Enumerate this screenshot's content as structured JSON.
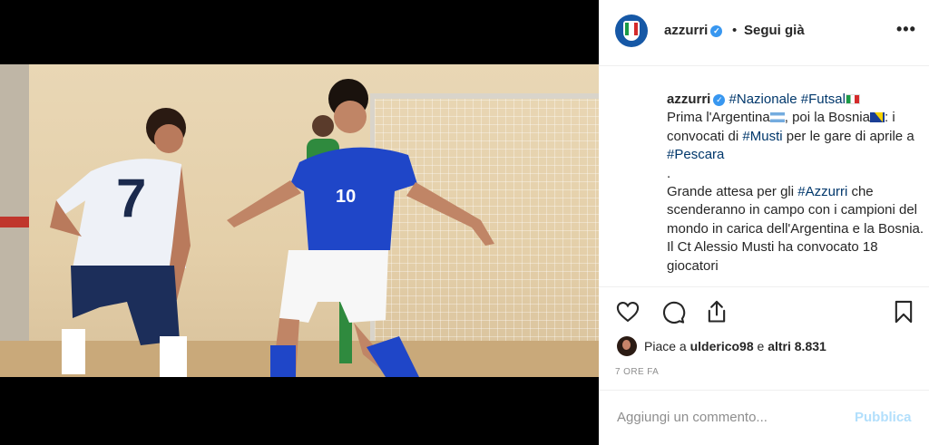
{
  "header": {
    "username": "azzurri",
    "separator": "•",
    "follow_label": "Segui già",
    "more": "•••"
  },
  "caption": {
    "username": "azzurri",
    "tags": [
      "#Nazionale",
      "#Futsal"
    ],
    "line2a": "Prima l'Argentina",
    "line2b": ", poi la Bosnia",
    "line2c": ": i convocati di ",
    "tag_musti": "#Musti",
    "line3": " per le gare di aprile a ",
    "tag_pescara": "#Pescara",
    "dot1": ".",
    "para_a": "Grande attesa per gli ",
    "tag_azzurri": "#Azzurri",
    "para_b": " che scenderanno in campo con i campioni del mondo in carica dell'Argentina e la Bosnia. Il Ct Alessio Musti ha convocato 18 giocatori",
    "dot2": "."
  },
  "actions": {
    "like": "heart-icon",
    "comment": "comment-icon",
    "share": "share-icon",
    "save": "bookmark-icon"
  },
  "likes": {
    "prefix": "Piace a ",
    "user": "ulderico98",
    "mid": " e ",
    "others": "altri 8.831"
  },
  "time": "7 ORE FA",
  "comment_box": {
    "placeholder": "Aggiungi un commento...",
    "publish_label": "Pubblica"
  },
  "colors": {
    "link": "#00376b",
    "verified": "#3897f0",
    "publish_disabled": "#b2dffc",
    "avatar_bg": "#1658a6"
  },
  "photo": {
    "player1_number": "7",
    "player2_number": "10"
  }
}
